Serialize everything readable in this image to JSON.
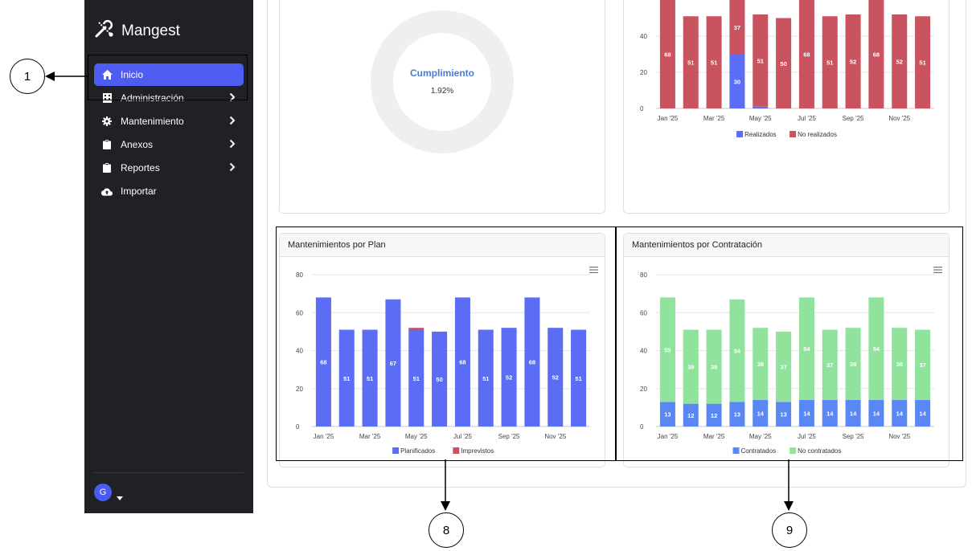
{
  "sidebar": {
    "brand": "Mangest",
    "items": [
      {
        "label": "Inicio",
        "icon": "home-icon",
        "active": true
      },
      {
        "label": "Administración",
        "icon": "building-icon",
        "chevron": true
      },
      {
        "label": "Mantenimiento",
        "icon": "gear-icon",
        "chevron": true
      },
      {
        "label": "Anexos",
        "icon": "clipboard-icon",
        "chevron": true
      },
      {
        "label": "Reportes",
        "icon": "clipboard-icon",
        "chevron": true
      },
      {
        "label": "Importar",
        "icon": "cloud-upload-icon"
      }
    ],
    "avatar": "G"
  },
  "cumplimiento": {
    "label": "Cumplimiento",
    "value": "1.92%"
  },
  "cards": {
    "plan_title": "Mantenimientos por Plan",
    "contratacion_title": "Mantenimientos por Contratación"
  },
  "annotations": {
    "a1": "1",
    "a8": "8",
    "a9": "9"
  },
  "colors": {
    "blue": "#5b6cf5",
    "red": "#c9545f",
    "green": "#8fe39c",
    "sidebar": "#202125",
    "active": "#4f5cf2"
  },
  "chart_data": [
    {
      "type": "bar",
      "stacked": true,
      "categories": [
        "Jan '25",
        "Feb '25",
        "Mar '25",
        "Apr '25",
        "May '25",
        "Jun '25",
        "Jul '25",
        "Aug '25",
        "Sep '25",
        "Oct '25",
        "Nov '25",
        "Dec '25"
      ],
      "tick_labels": [
        "Jan '25",
        "Mar '25",
        "May '25",
        "Jul '25",
        "Sep '25",
        "Nov '25"
      ],
      "series": [
        {
          "name": "Realizados",
          "color": "#5b6cf5",
          "values": [
            0,
            0,
            0,
            30,
            1,
            0,
            0,
            0,
            0,
            0,
            0,
            0
          ],
          "labels": [
            "",
            "",
            "",
            "30",
            "",
            "",
            "",
            "",
            "",
            "",
            "",
            ""
          ]
        },
        {
          "name": "No realizados",
          "color": "#c9545f",
          "values": [
            68,
            51,
            51,
            37,
            51,
            50,
            68,
            51,
            52,
            68,
            52,
            51
          ],
          "labels": [
            "68",
            "51",
            "51",
            "37",
            "51",
            "50",
            "68",
            "51",
            "52",
            "68",
            "52",
            "51"
          ]
        }
      ],
      "yticks": [
        0,
        20,
        40
      ],
      "ylim": [
        0,
        60
      ],
      "legend": "bottom"
    },
    {
      "type": "bar",
      "stacked": true,
      "categories": [
        "Jan '25",
        "Feb '25",
        "Mar '25",
        "Apr '25",
        "May '25",
        "Jun '25",
        "Jul '25",
        "Aug '25",
        "Sep '25",
        "Oct '25",
        "Nov '25",
        "Dec '25"
      ],
      "tick_labels": [
        "Jan '25",
        "Mar '25",
        "May '25",
        "Jul '25",
        "Sep '25",
        "Nov '25"
      ],
      "series": [
        {
          "name": "Planificados",
          "color": "#5b6cf5",
          "values": [
            68,
            51,
            51,
            67,
            51,
            50,
            68,
            51,
            52,
            68,
            52,
            51
          ],
          "labels": [
            "68",
            "51",
            "51",
            "67",
            "51",
            "50",
            "68",
            "51",
            "52",
            "68",
            "52",
            "51"
          ]
        },
        {
          "name": "Imprevistos",
          "color": "#c9545f",
          "values": [
            0,
            0,
            0,
            0,
            1,
            0,
            0,
            0,
            0,
            0,
            0,
            0
          ],
          "labels": [
            "",
            "",
            "",
            "",
            "",
            "",
            "",
            "",
            "",
            "",
            "",
            ""
          ]
        }
      ],
      "yticks": [
        0,
        20,
        40,
        60,
        80
      ],
      "ylim": [
        0,
        80
      ],
      "legend": "bottom"
    },
    {
      "type": "bar",
      "stacked": true,
      "categories": [
        "Jan '25",
        "Feb '25",
        "Mar '25",
        "Apr '25",
        "May '25",
        "Jun '25",
        "Jul '25",
        "Aug '25",
        "Sep '25",
        "Oct '25",
        "Nov '25",
        "Dec '25"
      ],
      "tick_labels": [
        "Jan '25",
        "Mar '25",
        "May '25",
        "Jul '25",
        "Sep '25",
        "Nov '25"
      ],
      "series": [
        {
          "name": "Contratados",
          "color": "#5b87f5",
          "values": [
            13,
            12,
            12,
            13,
            14,
            13,
            14,
            14,
            14,
            14,
            14,
            14
          ],
          "labels": [
            "13",
            "12",
            "12",
            "13",
            "14",
            "13",
            "14",
            "14",
            "14",
            "14",
            "14",
            "14"
          ]
        },
        {
          "name": "No contratados",
          "color": "#8fe39c",
          "values": [
            55,
            39,
            39,
            54,
            38,
            37,
            54,
            37,
            38,
            54,
            38,
            37
          ],
          "labels": [
            "55",
            "39",
            "39",
            "54",
            "38",
            "37",
            "54",
            "37",
            "38",
            "54",
            "38",
            "37"
          ]
        }
      ],
      "yticks": [
        0,
        20,
        40,
        60,
        80
      ],
      "ylim": [
        0,
        80
      ],
      "legend": "bottom"
    }
  ]
}
